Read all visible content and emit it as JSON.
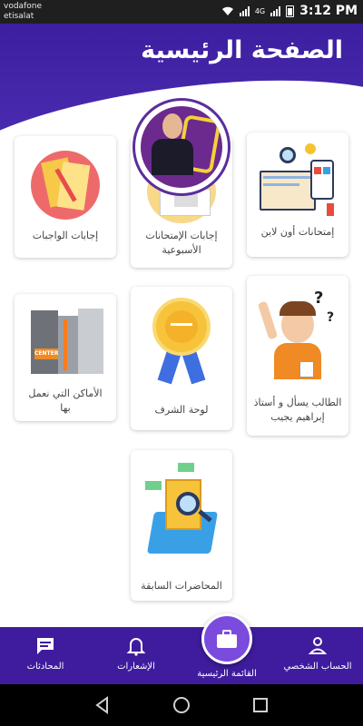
{
  "status_bar": {
    "carrier_1": "vodafone",
    "carrier_2": "etisalat",
    "time": "3:12 PM",
    "network_label": "4G"
  },
  "header": {
    "title": "الصفحة الرئيسية",
    "background_color": "#3c1fa0"
  },
  "cards": [
    {
      "id": "online-exams",
      "label": "إمتحانات أون لاين",
      "icon": "exam-online-illustration"
    },
    {
      "id": "weekly-exam-answers",
      "label_line1": "إجابات الإمتحانات",
      "label_line2": "الأسبوعية",
      "icon": "weekly-answers-illustration"
    },
    {
      "id": "homework-answers",
      "label": "إجابات الواجبات",
      "icon": "homework-illustration"
    },
    {
      "id": "ask-teacher",
      "label_line1": "الطالب يسأل و أستاذ",
      "label_line2": "إبراهيم يجيب",
      "icon": "student-question-illustration"
    },
    {
      "id": "honor-board",
      "label": "لوحة الشرف",
      "icon": "medal-illustration"
    },
    {
      "id": "locations",
      "label_line1": "الأماكن التي نعمل",
      "label_line2": "بها",
      "icon": "building-illustration",
      "sign_text": "CENTER"
    },
    {
      "id": "previous-lectures",
      "label": "المحاضرات السابقة",
      "icon": "lectures-illustration"
    }
  ],
  "bottom_nav": {
    "items": [
      {
        "label": "الحساب الشخصي",
        "icon": "person-icon"
      },
      {
        "label": "القائمة الرئيسية",
        "icon": "briefcase-icon"
      },
      {
        "label": "الإشعارات",
        "icon": "bell-icon"
      },
      {
        "label": "المحادثات",
        "icon": "chat-icon"
      }
    ],
    "background_color": "#3f1c9e",
    "active_color": "#7a4bdc"
  }
}
